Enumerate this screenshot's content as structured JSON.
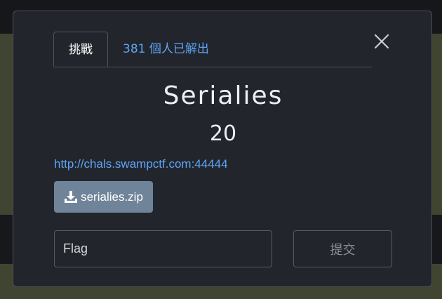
{
  "modal": {
    "tabs": {
      "challenge_label": "挑戰",
      "solves_label": "381 個人已解出"
    },
    "close_icon": "close-icon",
    "challenge": {
      "name": "Serialies",
      "points": "20",
      "link_text": "http://chals.swampctf.com:44444"
    },
    "file": {
      "label": "serialies.zip",
      "icon": "download-icon"
    },
    "flag_form": {
      "placeholder": "Flag",
      "value": "",
      "submit_label": "提交"
    }
  },
  "colors": {
    "modal_bg": "#22262c",
    "accent_link": "#5ea4f7",
    "file_button": "#6f8499",
    "backdrop_olive": "#3f4531"
  }
}
